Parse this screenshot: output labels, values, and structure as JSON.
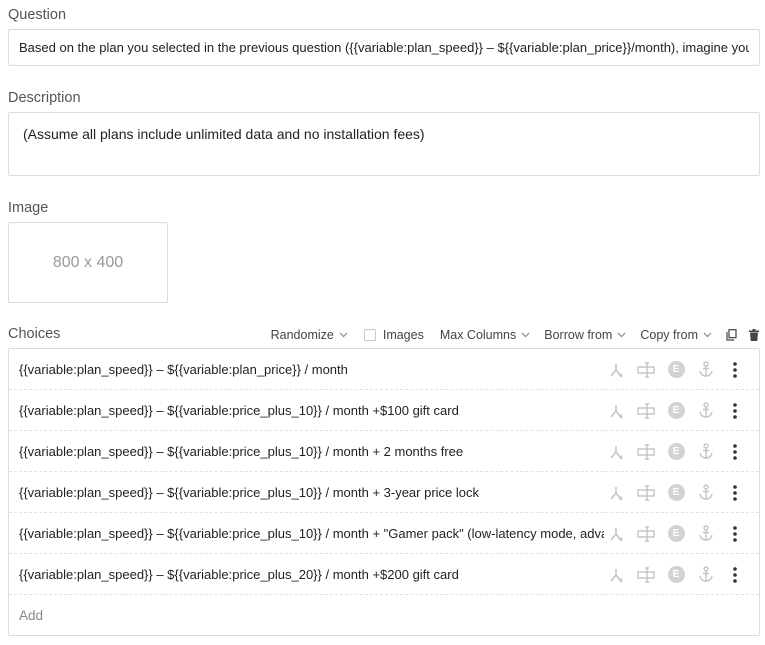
{
  "question": {
    "label": "Question",
    "value": "Based on the plan you selected in the previous question ({{variable:plan_speed}} – ${{variable:plan_price}}/month), imagine you"
  },
  "description": {
    "label": "Description",
    "value": "(Assume all plans include unlimited data and no installation fees)"
  },
  "image": {
    "label": "Image",
    "placeholder_text": "800 x 400"
  },
  "choices": {
    "label": "Choices",
    "toolbar": {
      "randomize": "Randomize",
      "images": "Images",
      "max_columns": "Max Columns",
      "borrow_from": "Borrow from",
      "copy_from": "Copy from"
    },
    "items": [
      "{{variable:plan_speed}} – ${{variable:plan_price}} / month",
      "{{variable:plan_speed}} – ${{variable:price_plus_10}} / month +$100 gift card",
      "{{variable:plan_speed}} – ${{variable:price_plus_10}} / month + 2 months free",
      "{{variable:plan_speed}} – ${{variable:price_plus_10}} / month + 3-year price lock",
      "{{variable:plan_speed}} – ${{variable:price_plus_10}} / month + \"Gamer pack\" (low-latency mode, adva",
      "{{variable:plan_speed}} – ${{variable:price_plus_20}} / month +$200 gift card"
    ],
    "row_badge": "E",
    "add_label": "Add"
  },
  "colors": {
    "border": "#dcdcdc",
    "icon_muted": "#c4c4c4",
    "icon_dark": "#333333"
  }
}
